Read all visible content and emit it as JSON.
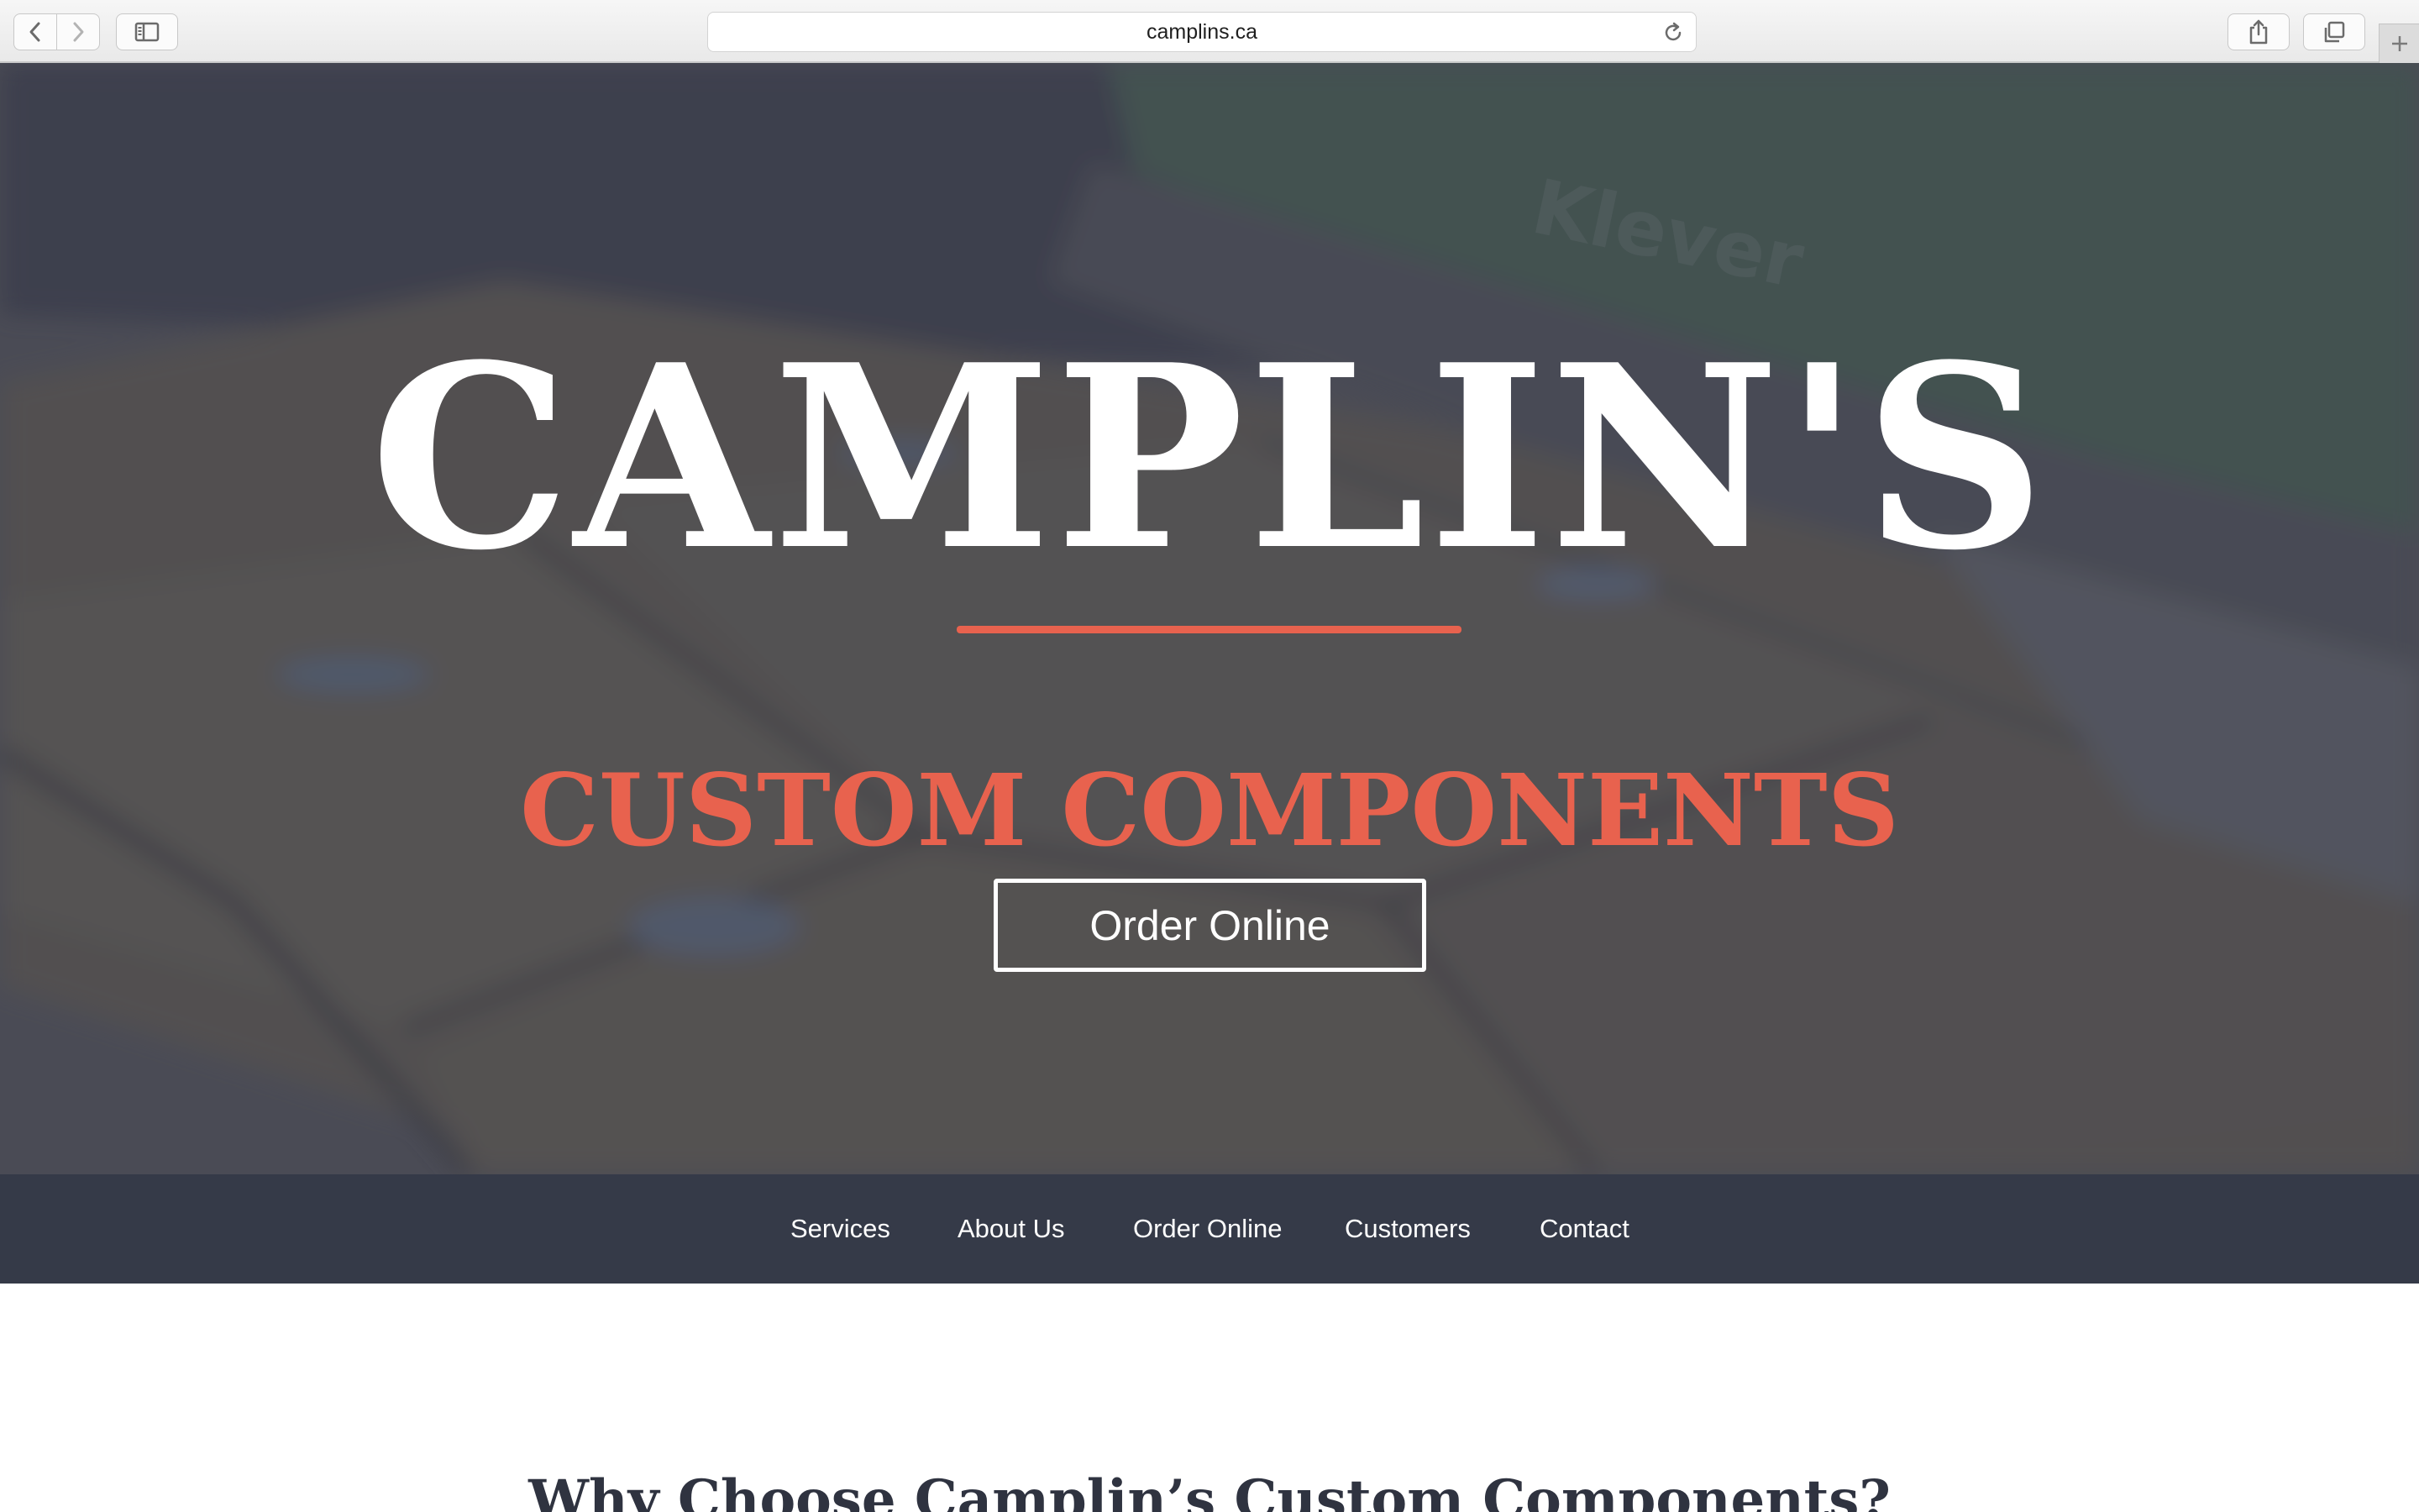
{
  "browser": {
    "url": "camplins.ca",
    "icons": {
      "back": "chevron-left-icon",
      "forward": "chevron-right-icon",
      "sidebar": "sidebar-icon",
      "reload": "reload-icon",
      "share": "share-icon",
      "tabs": "tabs-overview-icon",
      "new_tab": "plus-icon"
    }
  },
  "hero": {
    "title": "CAMPLIN'S",
    "subtitle": "CUSTOM COMPONENTS",
    "cta_label": "Order Online",
    "accent_color": "#e8624e"
  },
  "nav": {
    "items": [
      {
        "label": "Services"
      },
      {
        "label": "About Us"
      },
      {
        "label": "Order Online"
      },
      {
        "label": "Customers"
      },
      {
        "label": "Contact"
      }
    ],
    "background": "#353a48"
  },
  "content": {
    "heading": "Why Choose Camplin’s Custom Components?"
  }
}
